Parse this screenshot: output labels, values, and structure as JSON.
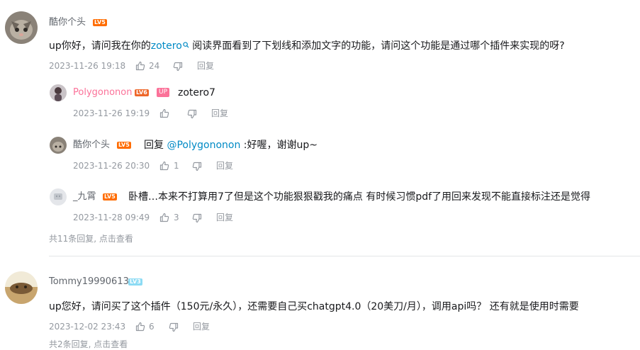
{
  "comments": [
    {
      "username": "酷你个头",
      "level": "LV5",
      "content_prefix": "up你好，请问我在你的",
      "content_link": "zotero",
      "content_suffix": " 阅读界面看到了下划线和添加文字的功能，请问这个功能是通过哪个插件来实现的呀?",
      "time": "2023-11-26 19:18",
      "likes": "24",
      "reply_label": "回复",
      "replies": [
        {
          "username": "Polygononon",
          "level": "LV6",
          "badge": "UP",
          "content": "zotero7",
          "time": "2023-11-26 19:19",
          "likes": "",
          "reply_label": "回复"
        },
        {
          "username": "酷你个头",
          "level": "LV5",
          "content_prefix": "回复 ",
          "mention": "@Polygononon",
          "content_suffix": " :好喔，谢谢up~",
          "time": "2023-11-26 20:30",
          "likes": "1",
          "reply_label": "回复"
        },
        {
          "username": "_九霄",
          "level": "LV5",
          "content": "卧槽…本来不打算用7了但是这个功能狠狠戳我的痛点 有时候习惯pdf了用回来发现不能直接标注还是觉得",
          "time": "2023-11-28 09:49",
          "likes": "3",
          "reply_label": "回复"
        }
      ],
      "more_replies": "共11条回复, 点击查看"
    },
    {
      "username": "Tommy19990613",
      "level": "LV3",
      "content": "up您好，请问买了这个插件（150元/永久），还需要自己买chatgpt4.0（20美刀/月），调用api吗？ 还有就是使用时需要",
      "time": "2023-12-02 23:43",
      "likes": "6",
      "reply_label": "回复",
      "more_replies": "共2条回复, 点击查看"
    }
  ],
  "colors": {
    "link": "#008ac5",
    "up_badge": "#fb7299",
    "meta": "#9499a0",
    "level_orange": "#ff6c00"
  },
  "icons": {
    "search": "search-icon",
    "like": "thumb-up-icon",
    "dislike": "thumb-down-icon"
  }
}
